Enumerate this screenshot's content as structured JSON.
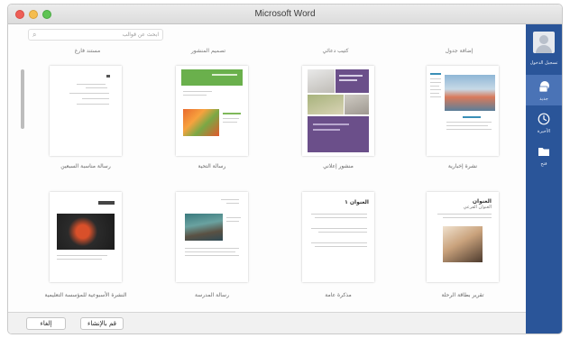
{
  "window": {
    "title": "Microsoft Word"
  },
  "search": {
    "placeholder": "ﺍﺑﺤﺚ ﻋﻦ ﻗﻮﺍﻟﺐ"
  },
  "columns": [
    "ﺇﺿﺎﻓﺔ ﺟﺪﻭﻝ",
    "ﻛﺘﻴﺐ ﺩﻋﺎﺋﻲ",
    "ﺗﺼﻤﻴﻢ ﺍﻟﻤﻨﺸﻮﺭ",
    "ﻣﺴﺘﻨﺪ ﻓﺎﺭﻍ"
  ],
  "templates_row1": [
    "ﺭﺳﺎﻟﺔ ﻣﻨﺎﺳﺒﺔ ﺍﻟﺴﺒﻌﻴﻦ",
    "ﺭﺳﺎﻟﺔ ﺍﻟﺘﺤﻴﺔ",
    "ﻣﻨﺸﻮﺭ ﺇﻋﻼﻧﻲ",
    "ﻧﺸﺮﺓ ﺇﺧﺒﺎﺭﻳﺔ"
  ],
  "templates_row2": [
    "ﺍﻟﻨﺸﺮﺓ ﺍﻷﺳﺒﻮﻋﻴﺔ ﻟﻠﻤﺆﺳﺴﺔ ﺍﻟﺘﻌﻠﻴﻤﻴﺔ",
    "ﺭﺳﺎﻟﺔ ﺍﻟﻤﺪﺭﺳﺔ",
    "ﻣﺬﻛﺮﺓ ﻋﺎﻣﺔ",
    "ﺗﻘﺮﻳﺮ ﺑﻄﺎﻗﺔ ﺍﻟﺮﺣﻠﺔ"
  ],
  "thumb_texts": {
    "title_doc": "ﺍﻟﻌﻨﻮﺍﻥ",
    "memo": "ﺍﻟﻌﻨﻮﺍﻥ ١",
    "report_title": "ﺍﻟﻌﻨﻮﺍﻥ",
    "report_sub": "ﺍﻟﻌﻨﻮﺍﻥ ﺍﻟﻔﺮﻋﻲ"
  },
  "sidebar": {
    "user": "ﺗﺴﺠﻴﻞ ﺍﻟﺪﺧﻮﻝ",
    "items": [
      {
        "label": "ﺟﺪﻳﺪ",
        "icon": "new-document-icon"
      },
      {
        "label": "ﺍﻷﺧﻴﺮﺓ",
        "icon": "clock-icon"
      },
      {
        "label": "ﻓﺘﺢ",
        "icon": "folder-icon"
      }
    ]
  },
  "buttons": {
    "cancel": "ﺇﻟﻐﺎﺀ",
    "create": "ﻗﻢ ﺑﺎﻹﻧﺸﺎﺀ"
  },
  "colors": {
    "sidebar": "#2a5599",
    "active": "#4a73b6",
    "green": "#6ab04c",
    "purple": "#6b4f8a"
  }
}
